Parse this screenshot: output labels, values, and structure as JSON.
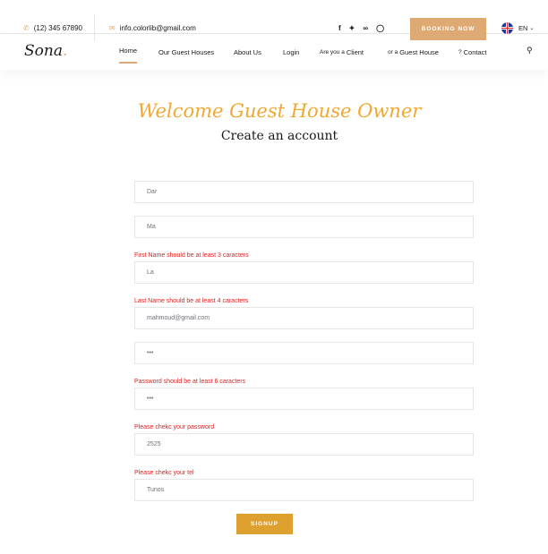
{
  "colors": {
    "accent": "#dfa974",
    "welcome": "#f0a830",
    "error": "#e51c1c",
    "button": "#dea02f"
  },
  "topbar": {
    "phone": "(12) 345 67890",
    "email": "info.colorlib@gmail.com",
    "social_icons": [
      "facebook-icon",
      "twitter-icon",
      "tripadvisor-icon",
      "instagram-icon"
    ],
    "booking_label": "BOOKING NOW",
    "language": "EN"
  },
  "nav": {
    "logo": "Sona",
    "items": [
      {
        "label": "Home"
      },
      {
        "label": "Our Guest Houses"
      },
      {
        "label": "About Us"
      },
      {
        "label": "Login"
      },
      {
        "prefix": "Are you a",
        "label": "Client"
      },
      {
        "prefix": "or a",
        "label": "Guest House"
      },
      {
        "prefix": "?",
        "label": "Contact"
      }
    ]
  },
  "heading": {
    "welcome": "Welcome Guest House Owner",
    "subtitle": "Create an account"
  },
  "form": {
    "first_name": "Dar",
    "last_name": "Ma",
    "error_first_name": "First Name should be at least 3 caracters",
    "field3": "La",
    "error_last_name": "Last Name should be at least 4 caracters",
    "email": "mahmoud@gmail.com",
    "password": "•••",
    "error_password": "Password should be at least 6 caracters",
    "confirm_password": "•••",
    "error_confirm": "Please chekc your password",
    "tel": "2525",
    "error_tel": "Please chekc your tel",
    "city": "Tunos",
    "submit_label": "SIGNUP"
  }
}
